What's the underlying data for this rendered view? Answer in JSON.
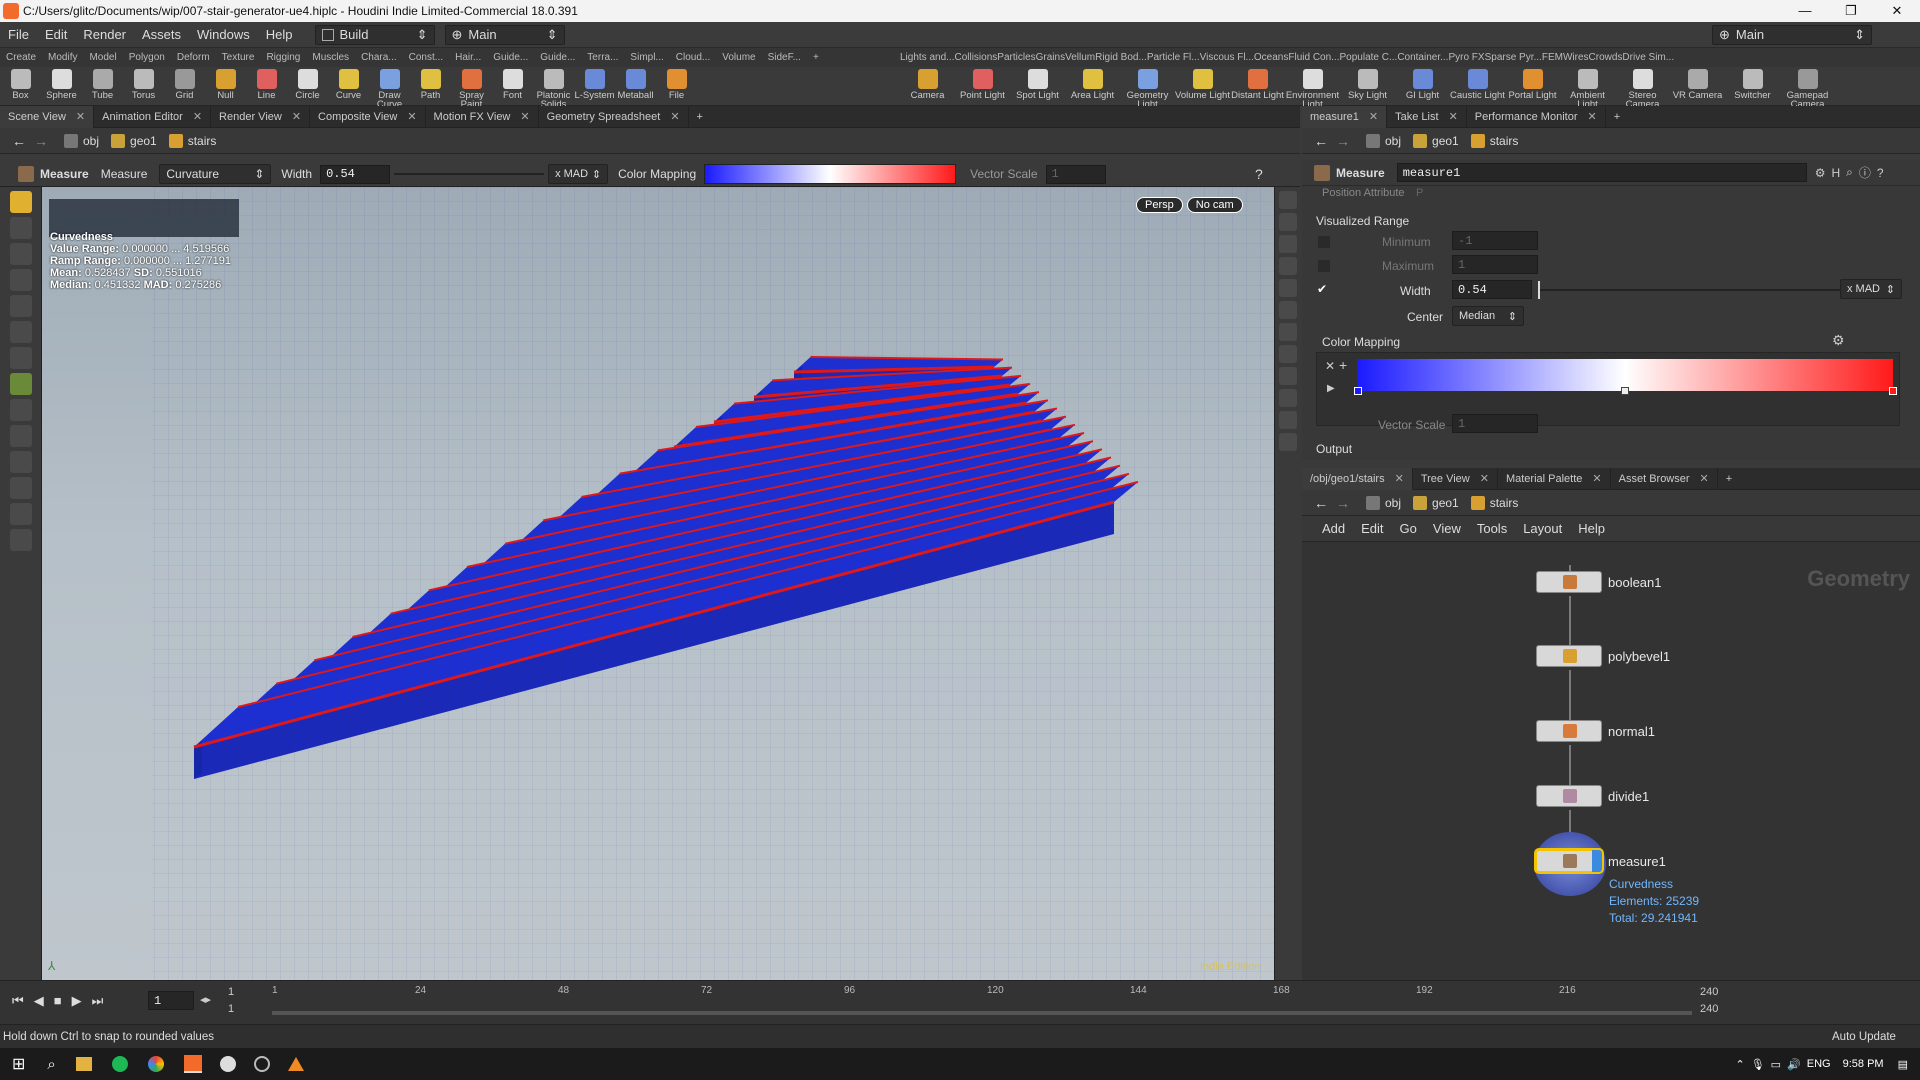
{
  "window": {
    "title": "C:/Users/glitc/Documents/wip/007-stair-generator-ue4.hiplc - Houdini Indie Limited-Commercial 18.0.391",
    "minimize": "—",
    "maximize": "❐",
    "close": "✕"
  },
  "menu": {
    "items": [
      "File",
      "Edit",
      "Render",
      "Assets",
      "Windows",
      "Help"
    ],
    "desktop": "Build",
    "network": "Main",
    "right_network": "Main"
  },
  "shelf_tabs_left": [
    "Create",
    "Modify",
    "Model",
    "Polygon",
    "Deform",
    "Texture",
    "Rigging",
    "Muscles",
    "Chara...",
    "Const...",
    "Hair...",
    "Guide...",
    "Guide...",
    "Terra...",
    "Simpl...",
    "Cloud...",
    "Volume",
    "SideF..."
  ],
  "shelf_tabs_right": [
    "Lights and...",
    "Collisions",
    "Particles",
    "Grains",
    "Vellum",
    "Rigid Bod...",
    "Particle Fl...",
    "Viscous Fl...",
    "Oceans",
    "Fluid Con...",
    "Populate C...",
    "Container...",
    "Pyro FX",
    "Sparse Pyr...",
    "FEM",
    "Wires",
    "Crowds",
    "Drive Sim..."
  ],
  "shelf_tools_left": [
    "Box",
    "Sphere",
    "Tube",
    "Torus",
    "Grid",
    "Null",
    "Line",
    "Circle",
    "Curve",
    "Draw Curve",
    "Path",
    "Spray Paint",
    "Font",
    "Platonic Solids",
    "L-System",
    "Metaball",
    "File"
  ],
  "shelf_tools_right": [
    "Camera",
    "Point Light",
    "Spot Light",
    "Area Light",
    "Geometry Light",
    "Volume Light",
    "Distant Light",
    "Environment Light",
    "Sky Light",
    "GI Light",
    "Caustic Light",
    "Portal Light",
    "Ambient Light",
    "Stereo Camera",
    "VR Camera",
    "Switcher",
    "Gamepad Camera"
  ],
  "left_tabs": [
    "Scene View",
    "Animation Editor",
    "Render View",
    "Composite View",
    "Motion FX View",
    "Geometry Spreadsheet"
  ],
  "path": {
    "obj": "obj",
    "geo": "geo1",
    "node": "stairs"
  },
  "opbar": {
    "tool": "Measure",
    "tool2": "Measure",
    "mode": "Curvature",
    "width_label": "Width",
    "width": "0.54",
    "xmad": "x MAD",
    "color_mapping": "Color Mapping",
    "vector_scale": "Vector Scale",
    "vector_scale_value": "1"
  },
  "viewport": {
    "persp": "Persp",
    "cam": "No cam",
    "watermark": "Indie Edition"
  },
  "hud": {
    "title": "Curvedness",
    "value_range_label": "Value Range:",
    "value_range": "0.000000 ... 4.519566",
    "ramp_range_label": "Ramp Range:",
    "ramp_range": "0.000000 ... 1.277191",
    "mean_label": "Mean:",
    "mean": "0.528437",
    "sd_label": "SD:",
    "sd": "0.551016",
    "median_label": "Median:",
    "median": "0.451332",
    "mad_label": "MAD:",
    "mad": "0.275286"
  },
  "right_tabs": [
    "measure1",
    "Take List",
    "Performance Monitor"
  ],
  "parm": {
    "type": "Measure",
    "name": "measure1",
    "position_attr": "Position Attribute",
    "position_attr_value": "P",
    "visualized_range": "Visualized Range",
    "minimum": "Minimum",
    "minimum_value": "-1",
    "maximum": "Maximum",
    "maximum_value": "1",
    "width": "Width",
    "width_value": "0.54",
    "xmad": "x MAD",
    "center": "Center",
    "center_value": "Median",
    "color_mapping": "Color Mapping",
    "vector_scale": "Vector Scale",
    "vector_scale_value": "1",
    "output": "Output"
  },
  "net_tabs": [
    "/obj/geo1/stairs",
    "Tree View",
    "Material Palette",
    "Asset Browser"
  ],
  "net_menu": [
    "Add",
    "Edit",
    "Go",
    "View",
    "Tools",
    "Layout",
    "Help"
  ],
  "net_context": "Geometry",
  "nodes": [
    {
      "name": "boolean1",
      "icon": "#c87a3a"
    },
    {
      "name": "polybevel1",
      "icon": "#d8a030"
    },
    {
      "name": "normal1",
      "icon": "#d87a3a"
    },
    {
      "name": "divide1",
      "icon": "#b08aa0"
    },
    {
      "name": "measure1",
      "icon": "#9a7a5a"
    }
  ],
  "measure_info": {
    "attr": "Curvedness",
    "elements": "Elements: 25239",
    "total": "Total: 29.241941"
  },
  "timeline": {
    "frame": "1",
    "start": "1",
    "start2": "1",
    "end": "240",
    "end2": "240",
    "ticks": [
      "1",
      "24",
      "48",
      "72",
      "96",
      "120",
      "144",
      "168",
      "192",
      "216"
    ]
  },
  "status": {
    "message": "Hold down Ctrl to snap to rounded values",
    "auto_update": "Auto Update"
  },
  "taskbar": {
    "lang": "ENG",
    "time": "9:58 PM"
  },
  "colors": {
    "ramp_low": "#1a1aff",
    "ramp_mid": "#ffffff",
    "ramp_high": "#ff1a1a",
    "stairs_blue": "#1d2fd0",
    "edge_red": "#e01818",
    "node_selected": "#f5c400"
  }
}
